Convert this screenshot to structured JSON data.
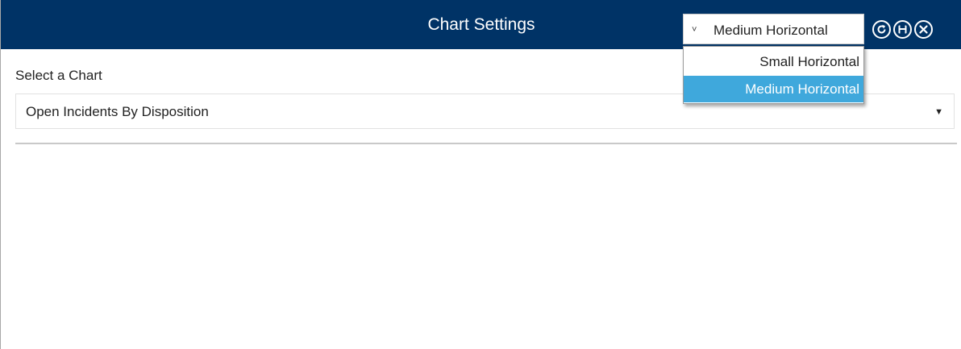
{
  "window": {
    "title": "Chart Settings",
    "title_bar_color": "#003366"
  },
  "size_selector": {
    "selected": "Medium Horizontal",
    "options": [
      "Small Horizontal",
      "Medium Horizontal"
    ],
    "highlight_color": "#3fa8dc",
    "expanded": true
  },
  "header_buttons": {
    "refresh_icon": "refresh-icon",
    "save_icon": "save-icon",
    "close_icon": "close-icon"
  },
  "chart_picker": {
    "label": "Select a Chart",
    "value": "Open Incidents By Disposition"
  }
}
